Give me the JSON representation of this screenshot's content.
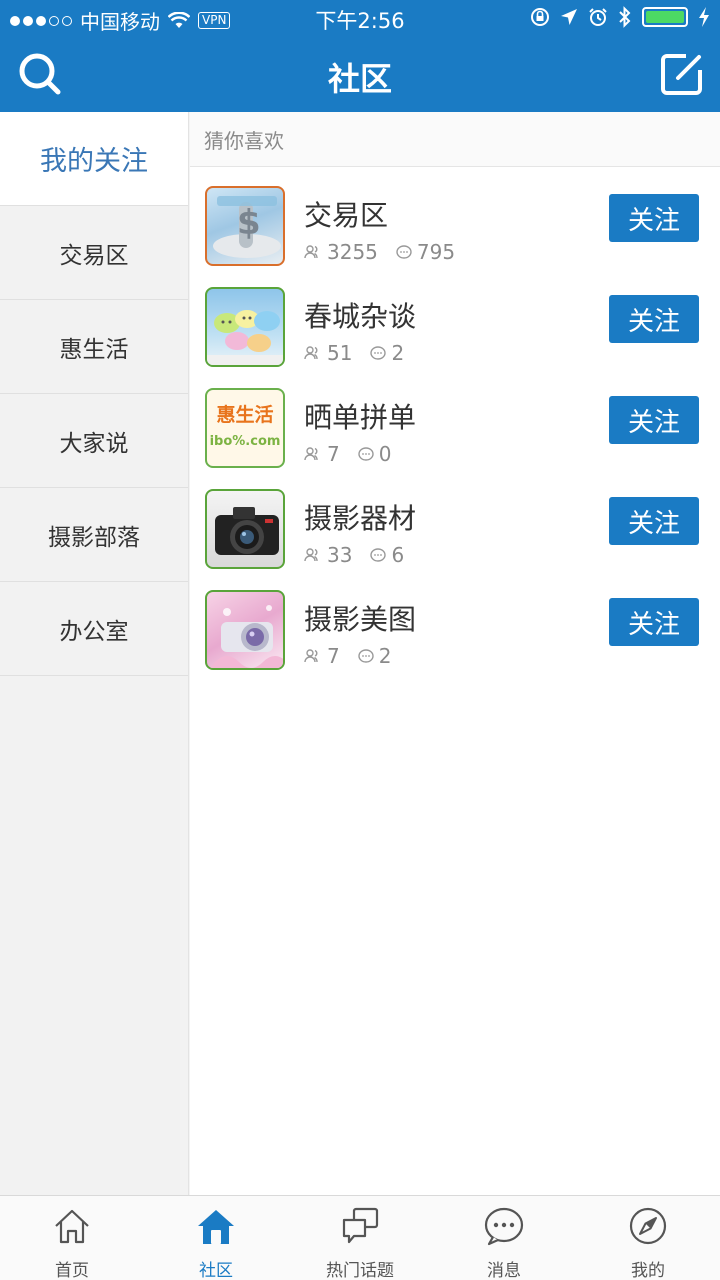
{
  "status_bar": {
    "carrier": "中国移动",
    "vpn": "VPN",
    "time": "下午2:56"
  },
  "nav": {
    "title": "社区",
    "left_icon": "search-icon",
    "right_icon": "compose-icon"
  },
  "sidebar": {
    "items": [
      {
        "label": "我的关注",
        "active": true
      },
      {
        "label": "交易区"
      },
      {
        "label": "惠生活"
      },
      {
        "label": "大家说"
      },
      {
        "label": "摄影部落"
      },
      {
        "label": "办公室"
      }
    ]
  },
  "main": {
    "section_title": "猜你喜欢",
    "communities": [
      {
        "name": "交易区",
        "members": "3255",
        "posts": "795",
        "follow_label": "关注"
      },
      {
        "name": "春城杂谈",
        "members": "51",
        "posts": "2",
        "follow_label": "关注"
      },
      {
        "name": "晒单拼单",
        "members": "7",
        "posts": "0",
        "follow_label": "关注",
        "thumb_text": "惠生活",
        "thumb_sub": "ibo%.com"
      },
      {
        "name": "摄影器材",
        "members": "33",
        "posts": "6",
        "follow_label": "关注"
      },
      {
        "name": "摄影美图",
        "members": "7",
        "posts": "2",
        "follow_label": "关注"
      }
    ]
  },
  "tabbar": {
    "tabs": [
      {
        "label": "首页",
        "icon": "home-icon"
      },
      {
        "label": "社区",
        "icon": "community-icon",
        "active": true
      },
      {
        "label": "热门话题",
        "icon": "hot-topics-icon"
      },
      {
        "label": "消息",
        "icon": "message-icon"
      },
      {
        "label": "我的",
        "icon": "compass-icon"
      }
    ]
  },
  "colors": {
    "brand": "#1a7bc4",
    "sidebar_active_text": "#3a77b6"
  }
}
